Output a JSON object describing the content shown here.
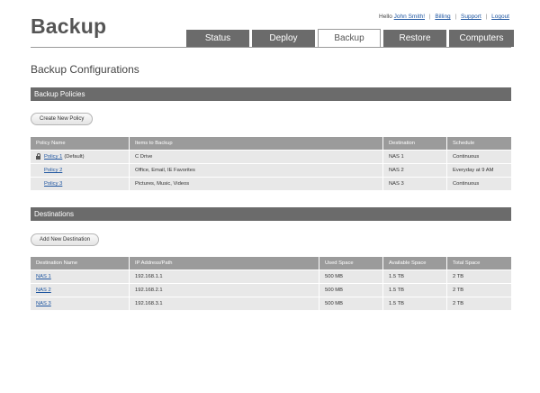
{
  "app": {
    "title": "Backup"
  },
  "user_links": {
    "greeting": "Hello",
    "user": "John Smith!",
    "billing": "Billing",
    "support": "Support",
    "logout": "Logout",
    "separator": "|"
  },
  "tabs": [
    {
      "label": "Status",
      "active": false
    },
    {
      "label": "Deploy",
      "active": false
    },
    {
      "label": "Backup",
      "active": true
    },
    {
      "label": "Restore",
      "active": false
    },
    {
      "label": "Computers",
      "active": false
    }
  ],
  "page": {
    "title": "Backup Configurations"
  },
  "policies": {
    "section_title": "Backup Policies",
    "create_button": "Create New Policy",
    "columns": [
      "Policy Name",
      "Items to Backup",
      "Destination",
      "Schedule"
    ],
    "rows": [
      {
        "name": "Policy 1",
        "suffix": "(Default)",
        "locked": true,
        "items": "C Drive",
        "destination": "NAS 1",
        "schedule": "Continuous"
      },
      {
        "name": "Policy 2",
        "suffix": "",
        "locked": false,
        "items": "Office, Email, IE Favorites",
        "destination": "NAS 2",
        "schedule": "Everyday at 9 AM"
      },
      {
        "name": "Policy 3",
        "suffix": "",
        "locked": false,
        "items": "Pictures, Music, Videos",
        "destination": "NAS 3",
        "schedule": "Continuous"
      }
    ]
  },
  "destinations": {
    "section_title": "Destinations",
    "add_button": "Add New Destination",
    "columns": [
      "Destination Name",
      "IP Address/Path",
      "Used Space",
      "Available Space",
      "Total Space"
    ],
    "rows": [
      {
        "name": "NAS 1",
        "ip": "192.168.1.1",
        "used": "500 MB",
        "available": "1.5 TB",
        "total": "2 TB"
      },
      {
        "name": "NAS 2",
        "ip": "192.168.2.1",
        "used": "500 MB",
        "available": "1.5 TB",
        "total": "2 TB"
      },
      {
        "name": "NAS 3",
        "ip": "192.168.3.1",
        "used": "500 MB",
        "available": "1.5 TB",
        "total": "2 TB"
      }
    ]
  }
}
